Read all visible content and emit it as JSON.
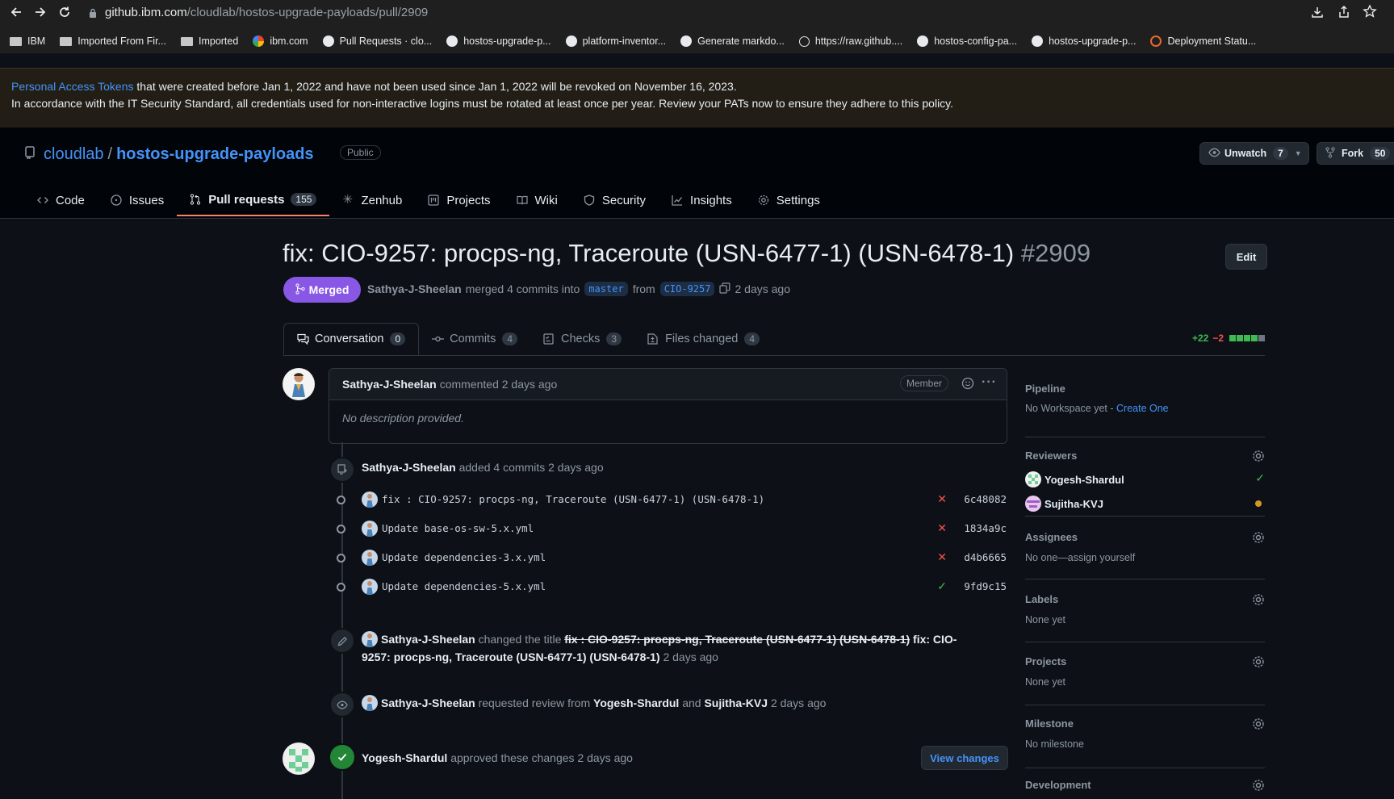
{
  "browser": {
    "url_host": "github.ibm.com",
    "url_path": "/cloudlab/hostos-upgrade-payloads/pull/2909",
    "bookmarks": [
      "IBM",
      "Imported From Fir...",
      "Imported",
      "ibm.com",
      "Pull Requests · clo...",
      "hostos-upgrade-p...",
      "platform-inventor...",
      "Generate markdo...",
      "https://raw.github....",
      "hostos-config-pa...",
      "hostos-upgrade-p...",
      "Deployment Statu..."
    ]
  },
  "banner": {
    "link": "Personal Access Tokens",
    "line1_rest": " that were created before Jan 1, 2022 and have not been used since Jan 1, 2022 will be revoked on November 16, 2023.",
    "line2": "In accordance with the IT Security Standard, all credentials used for non-interactive logins must be rotated at least once per year. Review your PATs now to ensure they adhere to this policy."
  },
  "repo": {
    "owner": "cloudlab",
    "sep": "/",
    "name": "hostos-upgrade-payloads",
    "visibility": "Public",
    "unwatch_label": "Unwatch",
    "watch_count": "7",
    "fork_label": "Fork",
    "fork_count": "50"
  },
  "tabs": [
    {
      "label": "Code",
      "icon": "code-icon"
    },
    {
      "label": "Issues",
      "icon": "issue-icon"
    },
    {
      "label": "Pull requests",
      "icon": "pull-request-icon",
      "count": "155"
    },
    {
      "label": "Zenhub",
      "icon": "zenhub-icon"
    },
    {
      "label": "Projects",
      "icon": "project-icon"
    },
    {
      "label": "Wiki",
      "icon": "book-icon"
    },
    {
      "label": "Security",
      "icon": "shield-icon"
    },
    {
      "label": "Insights",
      "icon": "graph-icon"
    },
    {
      "label": "Settings",
      "icon": "gear-icon"
    }
  ],
  "pr": {
    "title": "fix: CIO-9257: procps-ng, Traceroute (USN-6477-1) (USN-6478-1)",
    "number": "#2909",
    "edit_label": "Edit",
    "state": "Merged",
    "author": "Sathya-J-Sheelan",
    "merged_text": "merged 4 commits into",
    "base_branch": "master",
    "from_text": "from",
    "head_branch": "CIO-9257",
    "time": "2 days ago"
  },
  "pr_tabs": [
    {
      "label": "Conversation",
      "count": "0"
    },
    {
      "label": "Commits",
      "count": "4"
    },
    {
      "label": "Checks",
      "count": "3"
    },
    {
      "label": "Files changed",
      "count": "4"
    }
  ],
  "diffstat": {
    "additions": "+22",
    "deletions": "−2"
  },
  "comment": {
    "author": "Sathya-J-Sheelan",
    "action": "commented 2 days ago",
    "badge": "Member",
    "body": "No description provided."
  },
  "commits_event": {
    "author": "Sathya-J-Sheelan",
    "text": "added 4 commits 2 days ago"
  },
  "commits": [
    {
      "message": "fix : CIO-9257: procps-ng, Traceroute (USN-6477-1) (USN-6478-1)",
      "status": "✕",
      "sha": "6c48082",
      "status_color": "#f85149"
    },
    {
      "message": "Update base-os-sw-5.x.yml",
      "status": "✕",
      "sha": "1834a9c",
      "status_color": "#f85149"
    },
    {
      "message": "Update dependencies-3.x.yml",
      "status": "✕",
      "sha": "d4b6665",
      "status_color": "#f85149"
    },
    {
      "message": "Update dependencies-5.x.yml",
      "status": "✓",
      "sha": "9fd9c15",
      "status_color": "#3fb950"
    }
  ],
  "title_change": {
    "author": "Sathya-J-Sheelan",
    "text": "changed the title",
    "old_title": "fix : CIO-9257: procps-ng, Traceroute (USN-6477-1) (USN-6478-1)",
    "new_title_a": "fix: CIO-",
    "new_title_b": "9257: procps-ng, Traceroute (USN-6477-1) (USN-6478-1)",
    "time": "2 days ago"
  },
  "review_request": {
    "author": "Sathya-J-Sheelan",
    "text": "requested review from",
    "reviewer1": "Yogesh-Shardul",
    "and": "and",
    "reviewer2": "Sujitha-KVJ",
    "time": "2 days ago"
  },
  "approval": {
    "author": "Yogesh-Shardul",
    "text": "approved these changes 2 days ago",
    "button": "View changes"
  },
  "sidebar": {
    "pipeline": {
      "title": "Pipeline",
      "text": "No Workspace yet - ",
      "link": "Create One"
    },
    "reviewers": {
      "title": "Reviewers",
      "items": [
        {
          "name": "Yogesh-Shardul"
        },
        {
          "name": "Sujitha-KVJ"
        }
      ]
    },
    "assignees": {
      "title": "Assignees",
      "value": "No one—assign yourself"
    },
    "labels": {
      "title": "Labels",
      "value": "None yet"
    },
    "projects": {
      "title": "Projects",
      "value": "None yet"
    },
    "milestone": {
      "title": "Milestone",
      "value": "No milestone"
    },
    "development": {
      "title": "Development"
    }
  },
  "colors": {
    "accent": "#4493f8",
    "merged": "#8957e5",
    "success": "#3fb950",
    "danger": "#f85149",
    "pending": "#d29922"
  }
}
